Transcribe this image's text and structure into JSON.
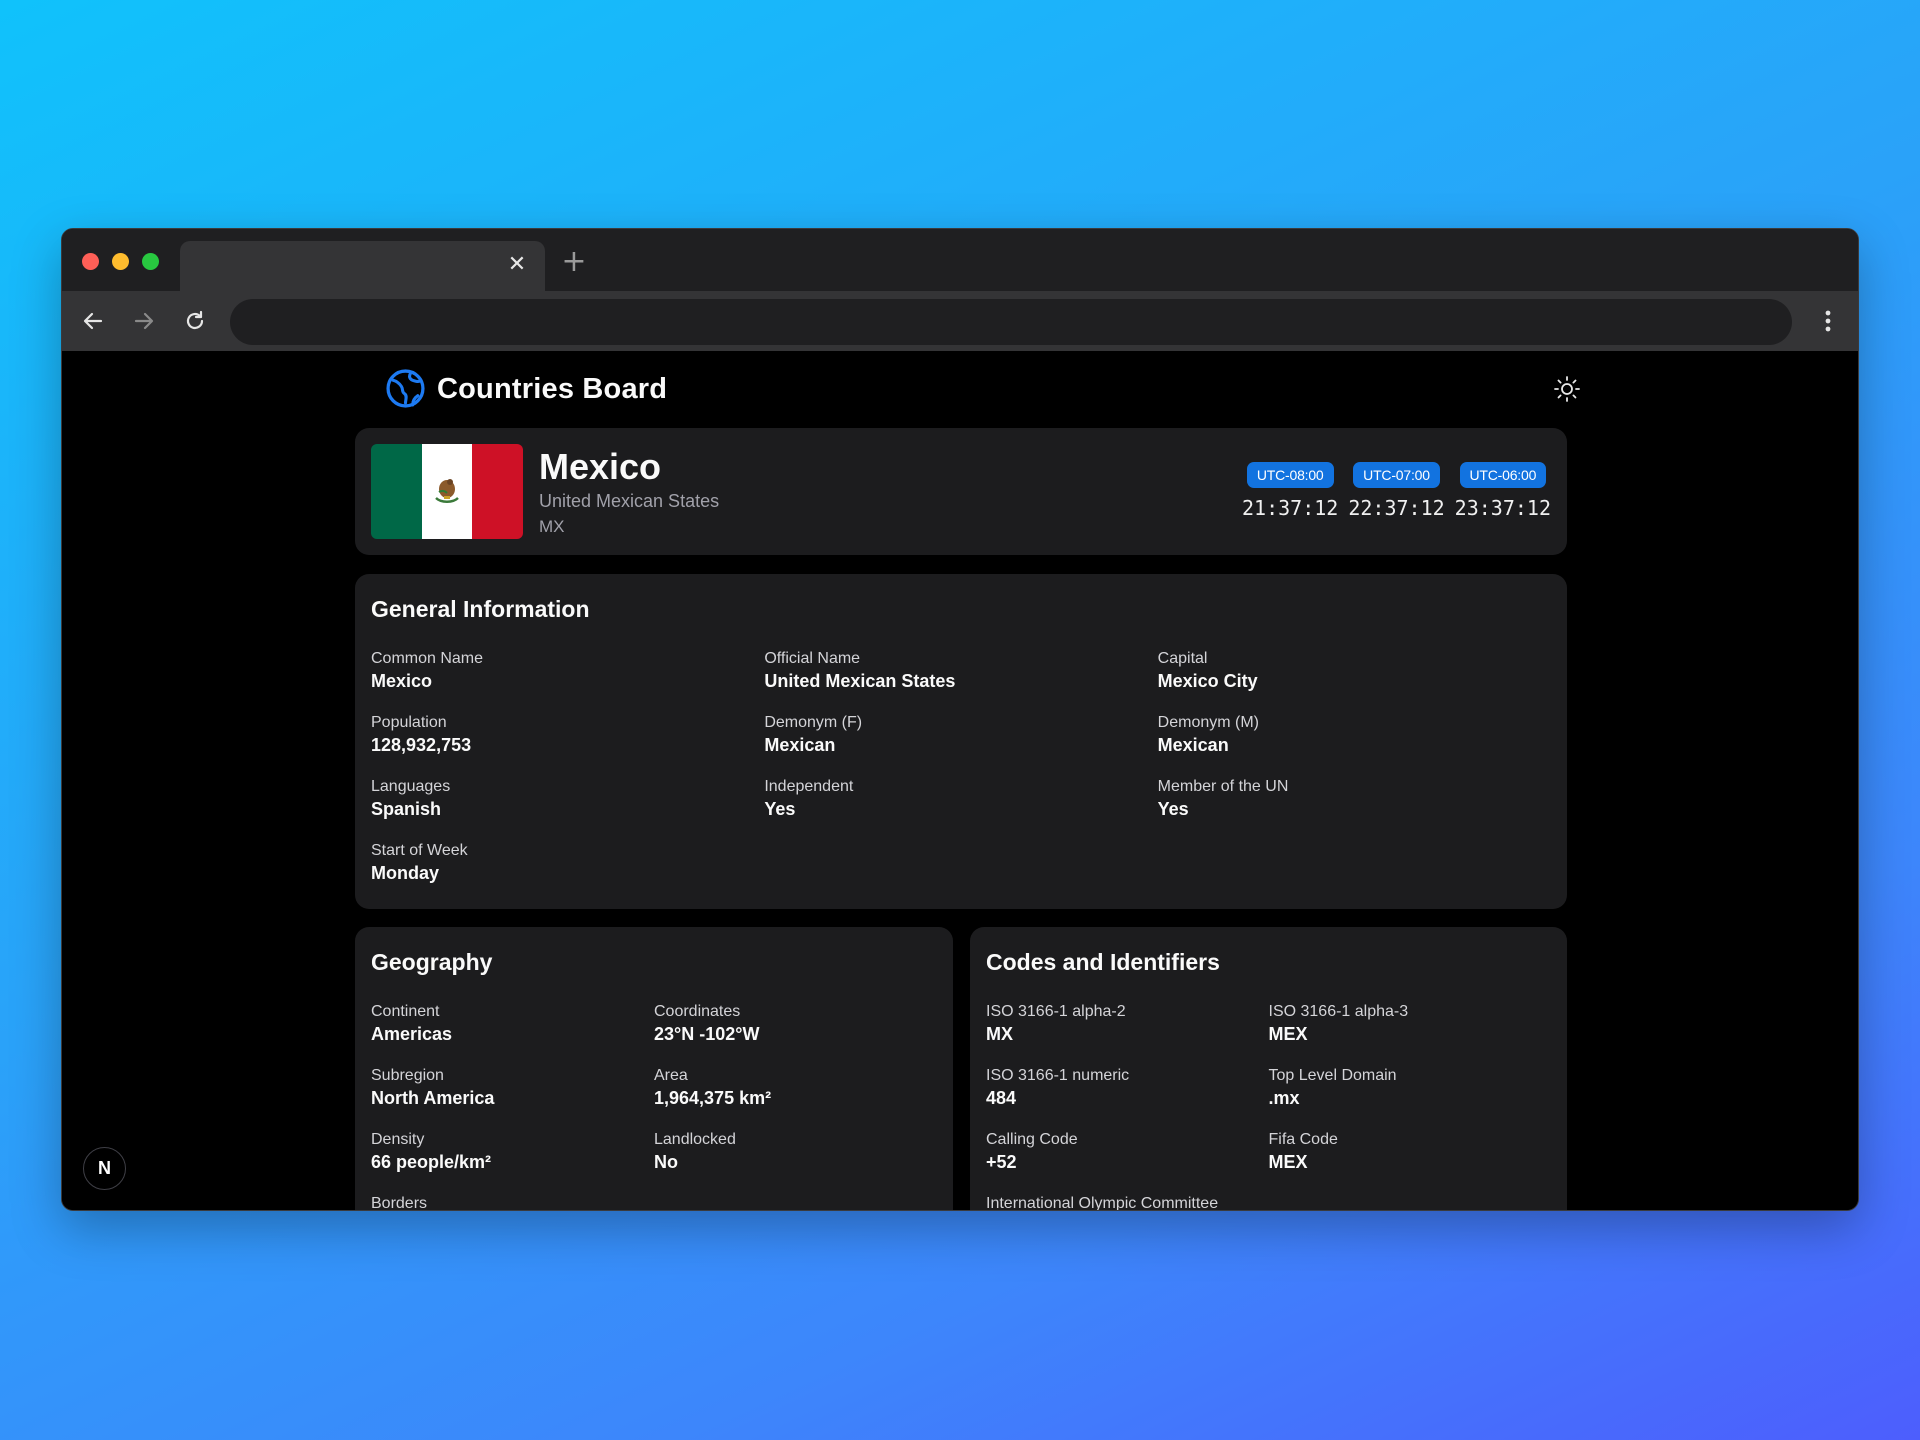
{
  "browser": {
    "tab_close": "✕",
    "new_tab": "+"
  },
  "app": {
    "brand": "Countries Board"
  },
  "country": {
    "name": "Mexico",
    "official_name": "United Mexican States",
    "code": "MX",
    "flag_colors": [
      "#006847",
      "#ffffff",
      "#ce1126"
    ]
  },
  "timezones": [
    {
      "label": "UTC-08:00",
      "time": "21:37:12"
    },
    {
      "label": "UTC-07:00",
      "time": "22:37:12"
    },
    {
      "label": "UTC-06:00",
      "time": "23:37:12"
    }
  ],
  "general": {
    "title": "General Information",
    "fields": [
      {
        "label": "Common Name",
        "value": "Mexico"
      },
      {
        "label": "Official Name",
        "value": "United Mexican States"
      },
      {
        "label": "Capital",
        "value": "Mexico City"
      },
      {
        "label": "Population",
        "value": "128,932,753"
      },
      {
        "label": "Demonym (F)",
        "value": "Mexican"
      },
      {
        "label": "Demonym (M)",
        "value": "Mexican"
      },
      {
        "label": "Languages",
        "value": "Spanish"
      },
      {
        "label": "Independent",
        "value": "Yes"
      },
      {
        "label": "Member of the UN",
        "value": "Yes"
      },
      {
        "label": "Start of Week",
        "value": "Monday"
      }
    ]
  },
  "geography": {
    "title": "Geography",
    "fields": [
      {
        "label": "Continent",
        "value": "Americas"
      },
      {
        "label": "Coordinates",
        "value": "23°N -102°W"
      },
      {
        "label": "Subregion",
        "value": "North America"
      },
      {
        "label": "Area",
        "value": "1,964,375 km²"
      },
      {
        "label": "Density",
        "value": "66 people/km²"
      },
      {
        "label": "Landlocked",
        "value": "No"
      },
      {
        "label": "Borders",
        "value": ""
      }
    ]
  },
  "codes": {
    "title": "Codes and Identifiers",
    "fields": [
      {
        "label": "ISO 3166-1 alpha-2",
        "value": "MX"
      },
      {
        "label": "ISO 3166-1 alpha-3",
        "value": "MEX"
      },
      {
        "label": "ISO 3166-1 numeric",
        "value": "484"
      },
      {
        "label": "Top Level Domain",
        "value": ".mx"
      },
      {
        "label": "Calling Code",
        "value": "+52"
      },
      {
        "label": "Fifa Code",
        "value": "MEX"
      },
      {
        "label": "International Olympic Committee",
        "value": ""
      }
    ]
  },
  "dev_badge": "N",
  "icons": [
    "back-arrow-icon",
    "forward-arrow-icon",
    "reload-icon",
    "more-vertical-icon",
    "globe-logo-icon",
    "sun-icon",
    "coat-of-arms-icon"
  ],
  "colors": {
    "accent": "#1273e0",
    "card": "#1c1c1e",
    "background": "#000000"
  }
}
